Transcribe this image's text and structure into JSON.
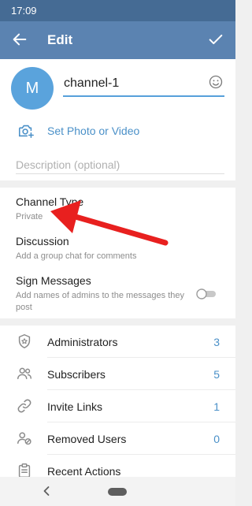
{
  "status_bar": {
    "time": "17:09"
  },
  "app_bar": {
    "title": "Edit"
  },
  "channel": {
    "avatar_letter": "M",
    "name": "channel-1",
    "set_photo_label": "Set Photo or Video",
    "description_placeholder": "Description (optional)"
  },
  "settings": {
    "channel_type": {
      "title": "Channel Type",
      "value": "Private"
    },
    "discussion": {
      "title": "Discussion",
      "subtitle": "Add a group chat for comments"
    },
    "sign_messages": {
      "title": "Sign Messages",
      "subtitle": "Add names of admins to the messages they post",
      "enabled": false
    }
  },
  "manage": [
    {
      "label": "Administrators",
      "count": "3",
      "icon": "shield-star-icon"
    },
    {
      "label": "Subscribers",
      "count": "5",
      "icon": "people-icon"
    },
    {
      "label": "Invite Links",
      "count": "1",
      "icon": "link-icon"
    },
    {
      "label": "Removed Users",
      "count": "0",
      "icon": "user-blocked-icon"
    },
    {
      "label": "Recent Actions",
      "count": "",
      "icon": "clipboard-icon"
    }
  ],
  "colors": {
    "status_bar": "#456b94",
    "app_bar": "#5b83b1",
    "accent": "#4a90c8",
    "annotation_arrow": "#e8201f"
  }
}
